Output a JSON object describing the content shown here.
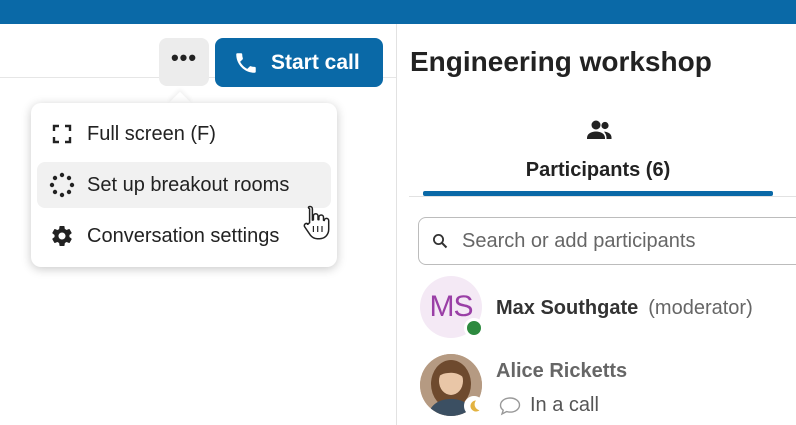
{
  "toolbar": {
    "more_label": "•••",
    "start_call_label": "Start call"
  },
  "menu": {
    "items": [
      {
        "label": "Full screen (F)",
        "icon": "fullscreen-icon"
      },
      {
        "label": "Set up breakout rooms",
        "icon": "breakout-rooms-icon"
      },
      {
        "label": "Conversation settings",
        "icon": "gear-icon"
      }
    ]
  },
  "conversation": {
    "title": "Engineering workshop"
  },
  "tabs": [
    {
      "label": "Participants (6)",
      "icon": "people-icon"
    }
  ],
  "search": {
    "placeholder": "Search or add participants"
  },
  "participants": [
    {
      "initials": "MS",
      "name": "Max Southgate",
      "role": "(moderator)",
      "status": "online"
    },
    {
      "name": "Alice Ricketts",
      "status_text": "In a call",
      "status": "away"
    }
  ],
  "colors": {
    "accent": "#0a69a7",
    "online": "#2d8a3f",
    "avatar_ms": "#9a3fa6"
  }
}
